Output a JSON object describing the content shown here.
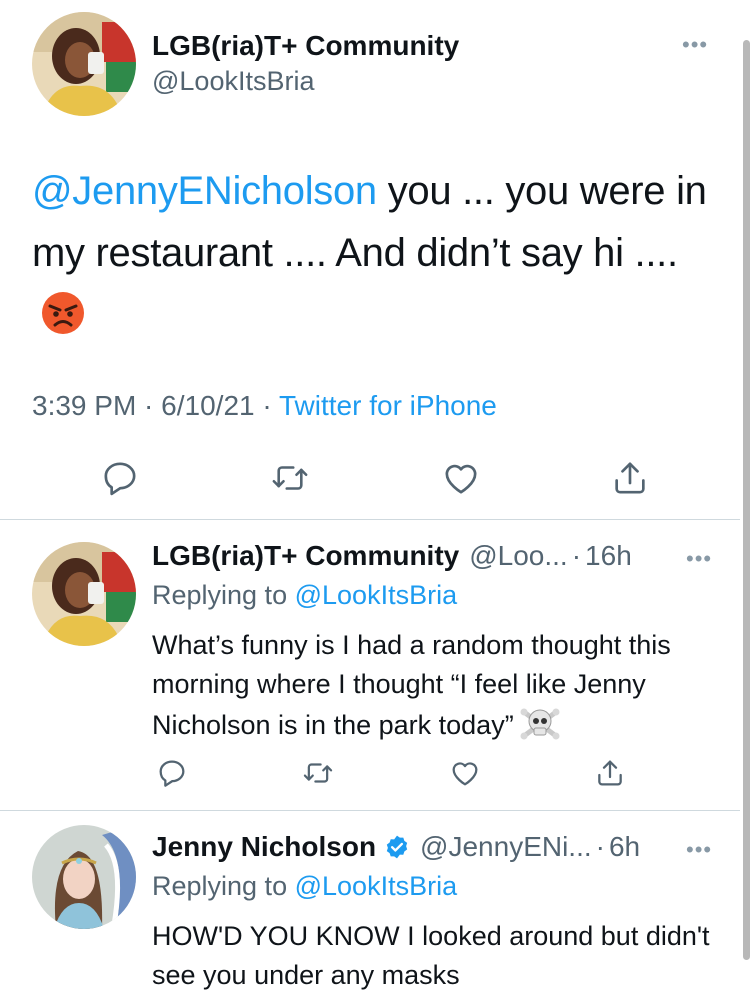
{
  "colors": {
    "link": "#1d9bf0",
    "muted": "#536471",
    "divider": "#cfd9de",
    "verified": "#1d9bf0",
    "angry_emoji": "#f0582c"
  },
  "main_tweet": {
    "author_name": "LGB(ria)T+ Community",
    "author_handle": "@LookItsBria",
    "text_mention": "@JennyENicholson",
    "text_body": " you ... you were in my restaurant .... And didn’t say hi ....",
    "emoji": "angry-face-icon",
    "time": "3:39 PM",
    "date": "6/10/21",
    "source": "Twitter for iPhone",
    "separator": " · "
  },
  "replies": [
    {
      "author_name": "LGB(ria)T+ Community",
      "author_handle": "@Loo...",
      "age": "16h",
      "replying_label": "Replying to",
      "replying_to": "@LookItsBria",
      "text": "What’s funny is I had a random thought this morning where I thought “I feel like Jenny Nicholson is in the park today”",
      "emoji": "skull-crossbones-icon"
    },
    {
      "author_name": "Jenny Nicholson",
      "verified": true,
      "author_handle": "@JennyENi...",
      "age": "6h",
      "replying_label": "Replying to",
      "replying_to": "@LookItsBria",
      "text": "HOW'D YOU KNOW I looked around but didn't see you under any masks"
    }
  ],
  "more_symbol": "•••",
  "dot_separator": "·",
  "icons": [
    "reply-icon",
    "retweet-icon",
    "like-icon",
    "share-icon",
    "more-icon",
    "verified-badge-icon"
  ]
}
